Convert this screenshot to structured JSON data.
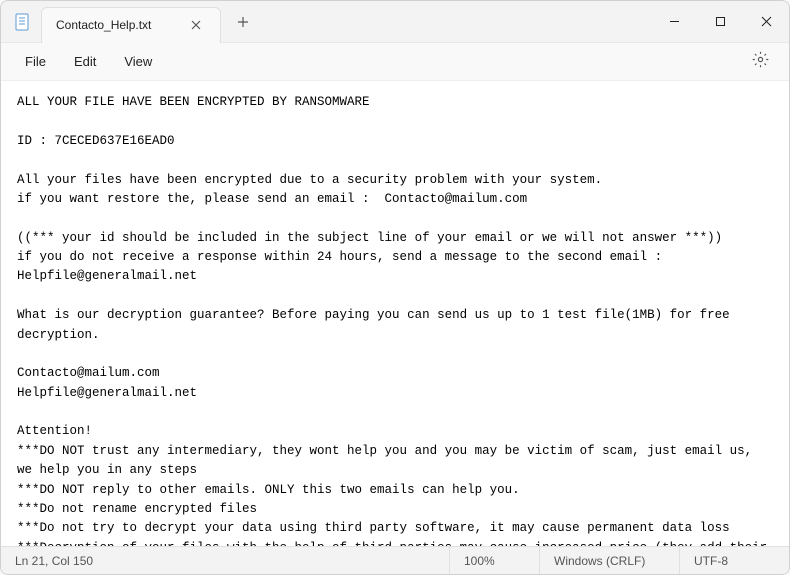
{
  "titlebar": {
    "tab_title": "Contacto_Help.txt"
  },
  "menubar": {
    "file": "File",
    "edit": "Edit",
    "view": "View"
  },
  "content": {
    "text": "ALL YOUR FILE HAVE BEEN ENCRYPTED BY RANSOMWARE\n\nID : 7CECED637E16EAD0\n\nAll your files have been encrypted due to a security problem with your system.\nif you want restore the, please send an email :  Contacto@mailum.com\n\n((*** your id should be included in the subject line of your email or we will not answer ***))\nif you do not receive a response within 24 hours, send a message to the second email : Helpfile@generalmail.net\n\nWhat is our decryption guarantee? Before paying you can send us up to 1 test file(1MB) for free decryption.\n\nContacto@mailum.com\nHelpfile@generalmail.net\n\nAttention!\n***DO NOT trust any intermediary, they wont help you and you may be victim of scam, just email us, we help you in any steps\n***DO NOT reply to other emails. ONLY this two emails can help you.\n***Do not rename encrypted files\n***Do not try to decrypt your data using third party software, it may cause permanent data loss\n***Decryption of your files with the help of third parties may cause increased price (they add their fee to our) or you can become a victim of a scam"
  },
  "statusbar": {
    "position": "Ln 21, Col 150",
    "zoom": "100%",
    "line_ending": "Windows (CRLF)",
    "encoding": "UTF-8"
  }
}
